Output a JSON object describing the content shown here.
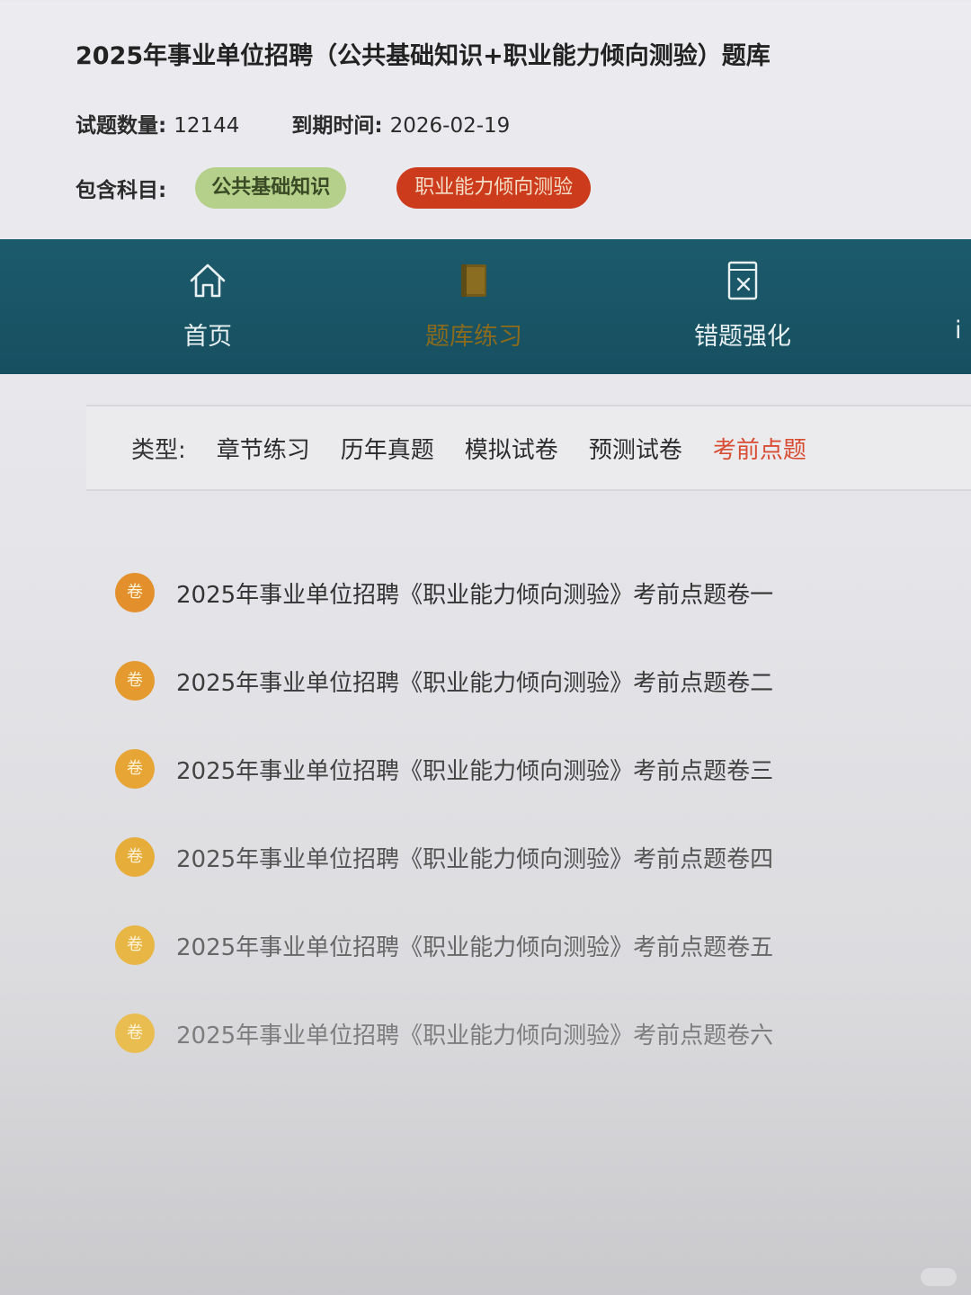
{
  "header": {
    "title": "2025年事业单位招聘（公共基础知识+职业能力倾向测验）题库",
    "question_count_label": "试题数量:",
    "question_count": "12144",
    "expiry_label": "到期时间:",
    "expiry_date": "2026-02-19",
    "subjects_label": "包含科目:",
    "subjects": [
      {
        "label": "公共基础知识",
        "color": "#b5d08a"
      },
      {
        "label": "职业能力倾向测验",
        "color": "#cc3b1c"
      }
    ]
  },
  "nav": {
    "background": "#1c5b6c",
    "items": [
      {
        "label": "首页",
        "icon": "home-icon"
      },
      {
        "label": "题库练习",
        "icon": "book-icon",
        "active": true
      },
      {
        "label": "错题强化",
        "icon": "wrong-question-icon"
      },
      {
        "label": "i",
        "icon": ""
      }
    ]
  },
  "filter": {
    "label": "类型:",
    "options": [
      "章节练习",
      "历年真题",
      "模拟试卷",
      "预测试卷",
      "考前点题"
    ],
    "active": "考前点题",
    "active_color": "#d84c33"
  },
  "papers": {
    "badge_text": "卷",
    "items": [
      "2025年事业单位招聘《职业能力倾向测验》考前点题卷一",
      "2025年事业单位招聘《职业能力倾向测验》考前点题卷二",
      "2025年事业单位招聘《职业能力倾向测验》考前点题卷三",
      "2025年事业单位招聘《职业能力倾向测验》考前点题卷四",
      "2025年事业单位招聘《职业能力倾向测验》考前点题卷五",
      "2025年事业单位招聘《职业能力倾向测验》考前点题卷六"
    ]
  }
}
